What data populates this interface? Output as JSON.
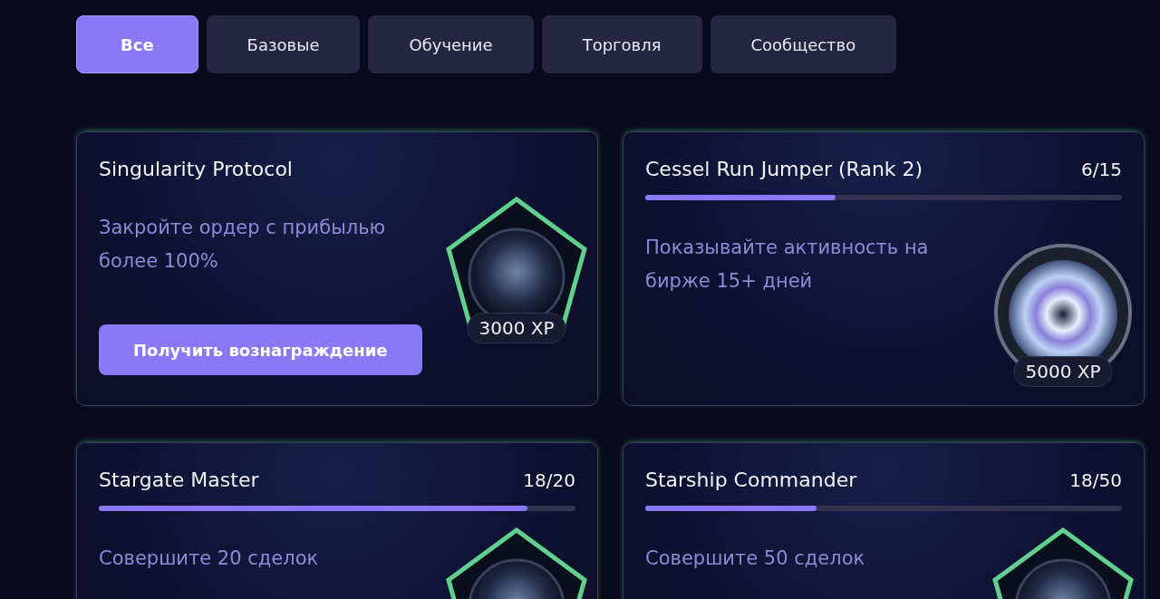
{
  "tabs": [
    {
      "label": "Все",
      "selected": true
    },
    {
      "label": "Базовые",
      "selected": false
    },
    {
      "label": "Обучение",
      "selected": false
    },
    {
      "label": "Торговля",
      "selected": false
    },
    {
      "label": "Сообщество",
      "selected": false
    }
  ],
  "cards": [
    {
      "title": "Singularity Protocol",
      "description": "Закройте ордер с прибылью более 100%",
      "button": "Получить вознаграждение",
      "badge": {
        "kind": "pentagon",
        "xp": "3000 XP"
      }
    },
    {
      "title": "Cessel Run Jumper (Rank 2)",
      "progress": {
        "text": "6/15",
        "level": 0.4
      },
      "description": "Показывайте активность на бирже 15+ дней",
      "badge": {
        "kind": "round",
        "xp": "5000 XP"
      }
    },
    {
      "title": "Stargate Master",
      "progress": {
        "text": "18/20",
        "level": 0.9
      },
      "description": "Совершите 20 сделок",
      "badge": {
        "kind": "pentagon"
      }
    },
    {
      "title": "Starship Commander",
      "progress": {
        "text": "18/50",
        "level": 0.36
      },
      "description": "Совершите 50 сделок",
      "badge": {
        "kind": "pentagon"
      }
    }
  ]
}
